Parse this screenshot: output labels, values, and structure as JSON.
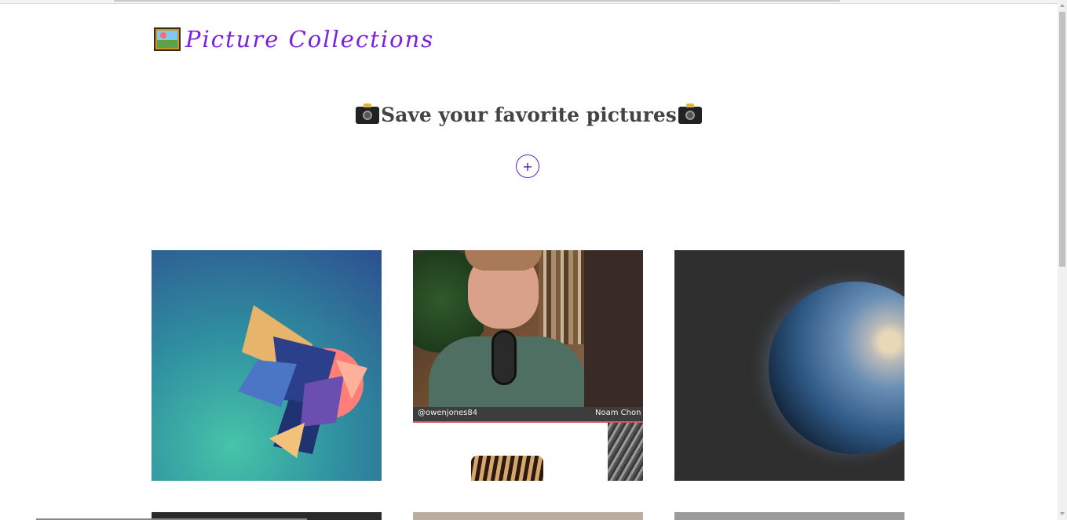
{
  "header": {
    "brand_icon": "framed-picture-icon",
    "title": "Picture Collections"
  },
  "hero": {
    "left_icon": "camera-icon",
    "headline": "Save your favorite pictures",
    "right_icon": "camera-icon",
    "add_button_label": "+"
  },
  "gallery": {
    "cards": [
      {
        "subject": "abstract low-poly geometric art on teal-blue gradient"
      },
      {
        "subject": "video still of man with microphone and bookshelf",
        "caption_left": "@owenjones84",
        "caption_right": "Noam Chon"
      },
      {
        "subject": "planet earth on dark background"
      }
    ]
  },
  "colors": {
    "brand": "#7b1fe0",
    "headline": "#444444",
    "add_button_border": "#6a1bd8"
  }
}
